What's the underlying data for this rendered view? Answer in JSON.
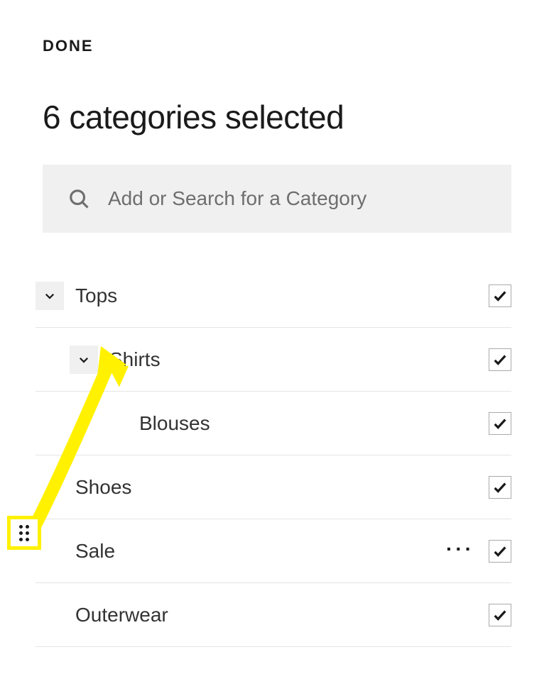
{
  "header": {
    "done_label": "DONE"
  },
  "title": "6 categories selected",
  "search": {
    "placeholder": "Add or Search for a Category"
  },
  "categories": [
    {
      "label": "Tops",
      "level": 0,
      "expandable": true,
      "checked": true,
      "has_more": false
    },
    {
      "label": "Shirts",
      "level": 1,
      "expandable": true,
      "checked": true,
      "has_more": false
    },
    {
      "label": "Blouses",
      "level": 2,
      "expandable": false,
      "checked": true,
      "has_more": false
    },
    {
      "label": "Shoes",
      "level": 0,
      "expandable": false,
      "checked": true,
      "has_more": false
    },
    {
      "label": "Sale",
      "level": 0,
      "expandable": false,
      "checked": true,
      "has_more": true
    },
    {
      "label": "Outerwear",
      "level": 0,
      "expandable": false,
      "checked": true,
      "has_more": false
    }
  ],
  "more_label": "···"
}
